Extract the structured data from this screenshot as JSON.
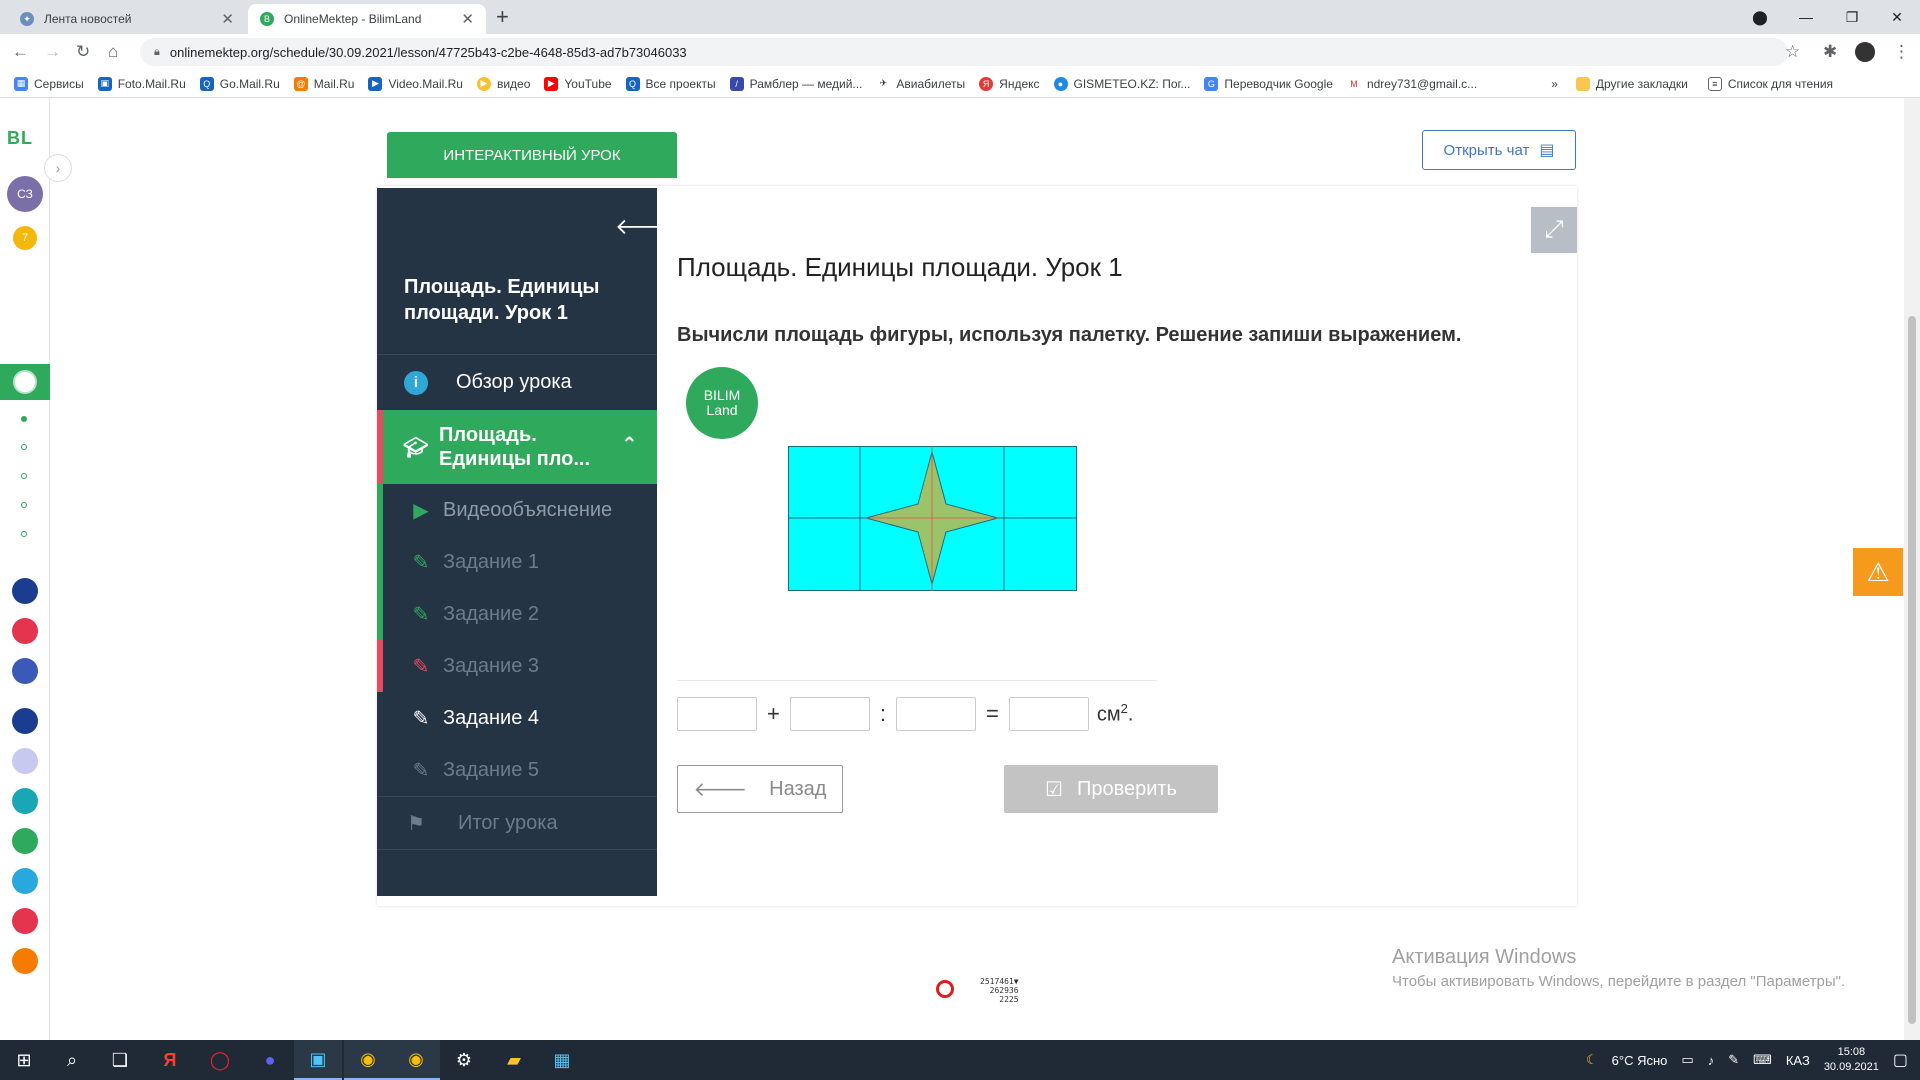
{
  "browser": {
    "tabs": [
      {
        "title": "Лента новостей"
      },
      {
        "title": "OnlineMektep - BilimLand"
      }
    ],
    "url": "onlinemektep.org/schedule/30.09.2021/lesson/47725b43-c2be-4648-85d3-ad7b73046033",
    "bookmarks": [
      "Сервисы",
      "Foto.Mail.Ru",
      "Go.Mail.Ru",
      "Mail.Ru",
      "Video.Mail.Ru",
      "видео",
      "YouTube",
      "Все проекты",
      "Рамблер — медий...",
      "Авиабилеты",
      "Яндекс",
      "GISMETEO.KZ: Пог...",
      "Переводчик Google",
      "ndrey731@gmail.c..."
    ],
    "bookmarks_more": "»",
    "other_bookmarks": "Другие закладки",
    "reading_list": "Список для чтения"
  },
  "rail": {
    "logo": "BL",
    "avatar": "СЗ",
    "badge": "7"
  },
  "header": {
    "interactive_lesson": "ИНТЕРАКТИВНЫЙ УРОК",
    "open_chat": "Открыть чат"
  },
  "sidebar": {
    "lesson_title": "Площадь. Единицы площади. Урок 1",
    "overview": "Обзор урока",
    "topic": "Площадь. Единицы пло...",
    "items": [
      {
        "label": "Видеообъяснение",
        "state": "video"
      },
      {
        "label": "Задание 1",
        "state": "done"
      },
      {
        "label": "Задание 2",
        "state": "done"
      },
      {
        "label": "Задание 3",
        "state": "fail"
      },
      {
        "label": "Задание 4",
        "state": "current"
      },
      {
        "label": "Задание 5",
        "state": "pending"
      }
    ],
    "result": "Итог урока"
  },
  "content": {
    "title": "Площадь. Единицы площади. Урок 1",
    "task": "Вычисли площадь фигуры, используя палетку. Решение запиши выражением.",
    "logo_line1": "BILIM",
    "logo_line2": "Land",
    "ops": [
      "+",
      ":",
      "="
    ],
    "unit": "см",
    "unit_power": "2",
    "unit_end": ".",
    "back": "Назад",
    "check": "Проверить"
  },
  "watermark": {
    "line1": "Активация Windows",
    "line2": "Чтобы активировать Windows, перейдите в раздел \"Параметры\"."
  },
  "counter": {
    "lines": [
      "2517461▼",
      "262936",
      "2225"
    ]
  },
  "taskbar": {
    "weather": "6°C Ясно",
    "lang": "КАЗ",
    "time": "15:08",
    "date": "30.09.2021"
  },
  "colors": {
    "accent_green": "#2fa95b",
    "nav_dark": "#253445",
    "fail_red": "#e84a5f",
    "grid_cyan": "#00ffff",
    "star_green": "#9bc36a"
  }
}
